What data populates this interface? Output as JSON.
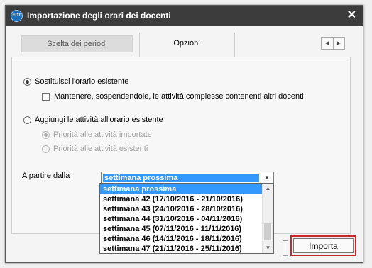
{
  "window": {
    "title": "Importazione degli orari dei docenti",
    "app_icon_text": "EDT"
  },
  "tabs": [
    {
      "label": "Scelta dei periodi"
    },
    {
      "label": "Opzioni"
    }
  ],
  "options": {
    "replace_label": "Sostituisci l'orario esistente",
    "keep_complex_label": "Mantenere, sospendendole, le attività complesse contenenti altri docenti",
    "add_label": "Aggiungi le attività all'orario esistente",
    "priority_imported_label": "Priorità alle attività importate",
    "priority_existing_label": "Priorità alle attività esistenti",
    "replace_checked": true,
    "keep_complex_checked": false,
    "add_checked": false,
    "priority_imported_checked": true,
    "priority_existing_checked": false
  },
  "start_from": {
    "label": "A partire dalla",
    "selected": "settimana prossima",
    "options": [
      "settimana prossima",
      "settimana 42 (17/10/2016 - 21/10/2016)",
      "settimana 43 (24/10/2016 - 28/10/2016)",
      "settimana 44 (31/10/2016 - 04/11/2016)",
      "settimana 45 (07/11/2016 - 11/11/2016)",
      "settimana 46 (14/11/2016 - 18/11/2016)",
      "settimana 47 (21/11/2016 - 25/11/2016)"
    ]
  },
  "buttons": {
    "import_label": "Importa"
  },
  "colors": {
    "titlebar": "#3c3c3c",
    "selection": "#3399ff",
    "highlight_border": "#c8282c"
  }
}
